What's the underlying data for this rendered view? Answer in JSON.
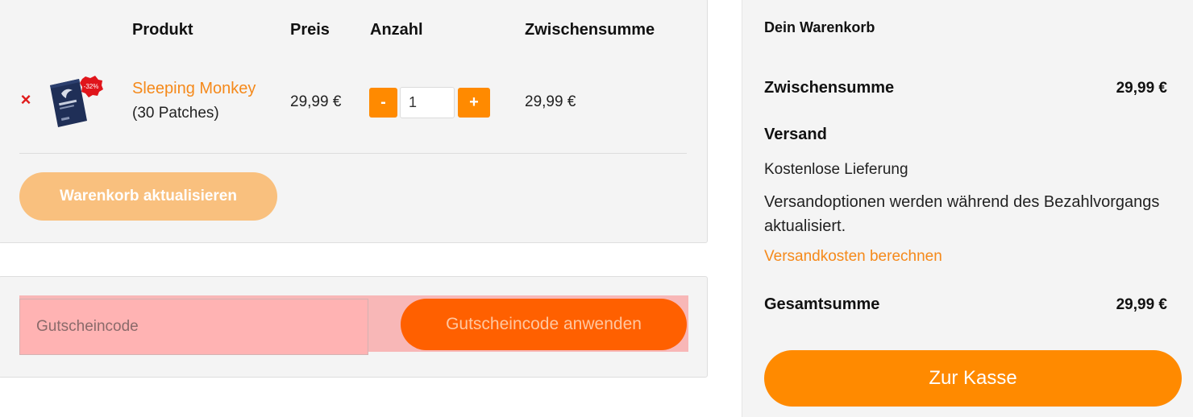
{
  "cart": {
    "columns": {
      "product": "Produkt",
      "price": "Preis",
      "quantity": "Anzahl",
      "subtotal": "Zwischensumme"
    },
    "items": [
      {
        "remove_symbol": "×",
        "image_icon": "sleeping-monkey-package",
        "badge": "-32%",
        "name": "Sleeping Monkey",
        "variant": "(30 Patches)",
        "price": "29,99 €",
        "qty_minus": "-",
        "quantity": "1",
        "qty_plus": "+",
        "subtotal": "29,99 €"
      }
    ],
    "update_button": "Warenkorb aktualisieren"
  },
  "coupon": {
    "placeholder": "Gutscheincode",
    "apply_button": "Gutscheincode anwenden"
  },
  "totals": {
    "title": "Dein Warenkorb",
    "subtotal_label": "Zwischensumme",
    "subtotal_value": "29,99 €",
    "shipping_label": "Versand",
    "shipping_method": "Kostenlose Lieferung",
    "shipping_note": "Versandoptionen werden während des Bezahlvorgangs aktualisiert.",
    "shipping_calc_link": "Versandkosten berechnen",
    "total_label": "Gesamtsumme",
    "total_value": "29,99 €",
    "checkout_button": "Zur Kasse"
  },
  "colors": {
    "accent": "#ff8a00",
    "link": "#f5891a",
    "remove": "#e01b1b",
    "coupon_button": "#ff6000",
    "update_button_disabled": "#f9c07e",
    "panel_bg": "#f4f4f4"
  }
}
